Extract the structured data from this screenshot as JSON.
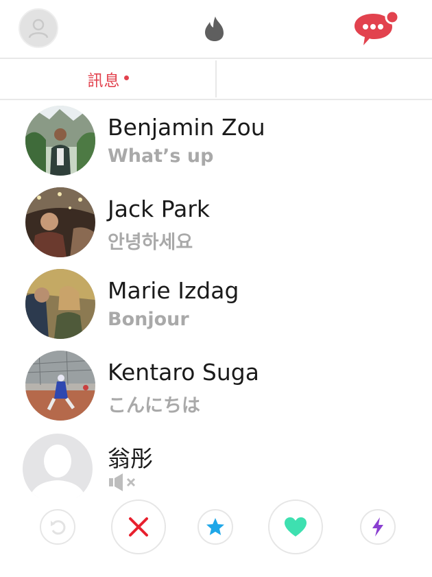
{
  "header": {
    "profile_icon": "user-silhouette-icon",
    "flame_icon": "flame-icon",
    "chat_icon": "chat-bubble-icon",
    "chat_has_notification": true
  },
  "tabs": {
    "messages_label": "訊息",
    "messages_has_dot": true
  },
  "conversations": [
    {
      "name": "Benjamin Zou",
      "preview": "What’s up",
      "avatar": "photo"
    },
    {
      "name": "Jack Park",
      "preview": "안녕하세요",
      "avatar": "photo"
    },
    {
      "name": "Marie Izdag",
      "preview": "Bonjour",
      "avatar": "photo"
    },
    {
      "name": "Kentaro Suga",
      "preview": "こんにちは",
      "avatar": "photo"
    },
    {
      "name": "翁彤",
      "preview_icon": "muted-speaker-icon",
      "avatar": "placeholder"
    }
  ],
  "actions": [
    {
      "icon": "undo-icon"
    },
    {
      "icon": "close-icon"
    },
    {
      "icon": "star-icon"
    },
    {
      "icon": "heart-icon"
    },
    {
      "icon": "bolt-icon"
    }
  ],
  "colors": {
    "accent": "#e2424e",
    "name_text": "#1a1a1a",
    "preview_text": "#a9a9a9",
    "nope": "#e8202e",
    "super_like": "#1ea7e8",
    "like": "#3ee0b0",
    "boost": "#8a3fd1",
    "divider": "#e8e8e8"
  }
}
